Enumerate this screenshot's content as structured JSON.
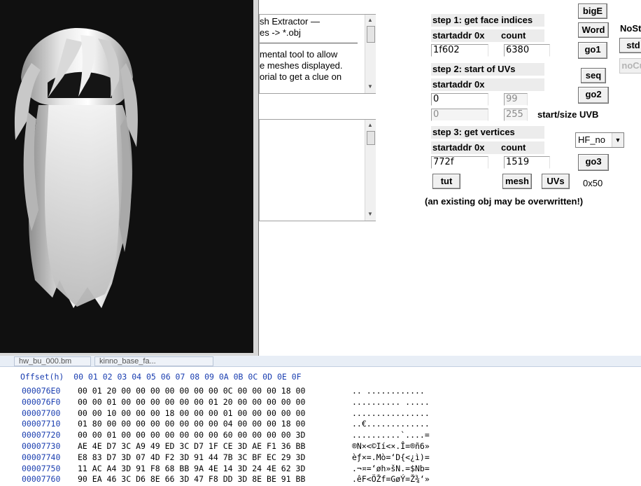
{
  "info_box": {
    "line1": "sh Extractor  —",
    "line2": "es -> *.obj",
    "line3": "mental tool to allow",
    "line4": "e meshes displayed.",
    "line5": "orial to get a clue on"
  },
  "step1": {
    "title": "step 1: get face indices",
    "startaddr_label": "startaddr 0x",
    "count_label": "count",
    "startaddr": "1f602",
    "count": "6380",
    "go_label": "go1"
  },
  "step2": {
    "title": "step 2: start of UVs",
    "startaddr_label": "startaddr 0x",
    "startaddr": "0",
    "uv_count": "99",
    "uvb_start": "0",
    "uvb_size": "255",
    "uvb_label": "start/size UVB",
    "go_label": "go2"
  },
  "step3": {
    "title": "step 3: get vertices",
    "startaddr_label": "startaddr 0x",
    "count_label": "count",
    "startaddr": "772f",
    "count": "1519",
    "go_label": "go3"
  },
  "buttons": {
    "bigE": "bigE",
    "word": "Word",
    "seq": "seq",
    "nost": "NoSt",
    "std": "std",
    "nocu": "noCu",
    "tut": "tut",
    "mesh": "mesh",
    "uvs": "UVs"
  },
  "hex_value": "0x50",
  "dropdown_value": "HF_no",
  "warning": "(an existing obj may be overwritten!)",
  "tabs": [
    "hw_bu_000.bm",
    "kinno_base_fa..."
  ],
  "hex_view": {
    "header": "Offset(h)  00 01 02 03 04 05 06 07 08 09 0A 0B 0C 0D 0E 0F",
    "rows": [
      {
        "offset": "000076E0",
        "bytes": "00 01 20 00 00 00 00 00 00 00 0C 00 00 00 18 00",
        "ascii": ".. ............"
      },
      {
        "offset": "000076F0",
        "bytes": "00 00 01 00 00 00 00 00 00 01 20 00 00 00 00 00",
        "ascii": ".......... ....."
      },
      {
        "offset": "00007700",
        "bytes": "00 00 10 00 00 00 18 00 00 00 01 00 00 00 00 00",
        "ascii": "................"
      },
      {
        "offset": "00007710",
        "bytes": "01 80 00 00 00 00 00 00 00 00 04 00 00 00 18 00",
        "ascii": "..€............."
      },
      {
        "offset": "00007720",
        "bytes": "00 00 01 00 00 00 00 00 00 00 60 00 00 00 00 3D",
        "ascii": "..........`....="
      },
      {
        "offset": "00007730",
        "bytes": "AE 4E D7 3C A9 49 ED 3C D7 1F CE 3D AE F1 36 BB",
        "ascii": "®N×<©Ií<×.Î=®ñ6»"
      },
      {
        "offset": "00007740",
        "bytes": "E8 83 D7 3D 07 4D F2 3D 91 44 7B 3C BF EC 29 3D",
        "ascii": "èƒ×=.Mò=‘D{<¿ì)="
      },
      {
        "offset": "00007750",
        "bytes": "11 AC A4 3D 91 F8 68 BB 9A 4E 14 3D 24 4E 62 3D",
        "ascii": ".¬¤=‘øh»šN.=$Nb="
      },
      {
        "offset": "00007760",
        "bytes": "90 EA 46 3C D6 8E 66 3D 47 F8 DD 3D 8E BE 91 BB",
        "ascii": ".êF<ÖŽf=GøÝ=Ž¾‘»"
      }
    ]
  }
}
